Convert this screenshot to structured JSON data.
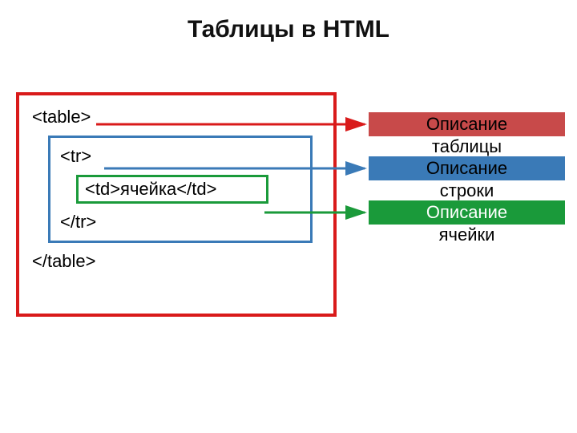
{
  "title": "Таблицы в HTML",
  "code": {
    "table_open": "<table>",
    "tr_open": "<tr>",
    "td_line": "<td>ячейка</td>",
    "tr_close": "</tr>",
    "table_close": "</table>"
  },
  "labels": {
    "table": {
      "line1": "Описание",
      "line2": "таблицы"
    },
    "row": {
      "line1": "Описание",
      "line2": "строки"
    },
    "cell": {
      "line1": "Описание",
      "line2": "ячейки"
    }
  },
  "colors": {
    "red": "#d91a1a",
    "red_fill": "#c84a4a",
    "blue": "#3a7ab7",
    "green": "#1a9a3a"
  }
}
